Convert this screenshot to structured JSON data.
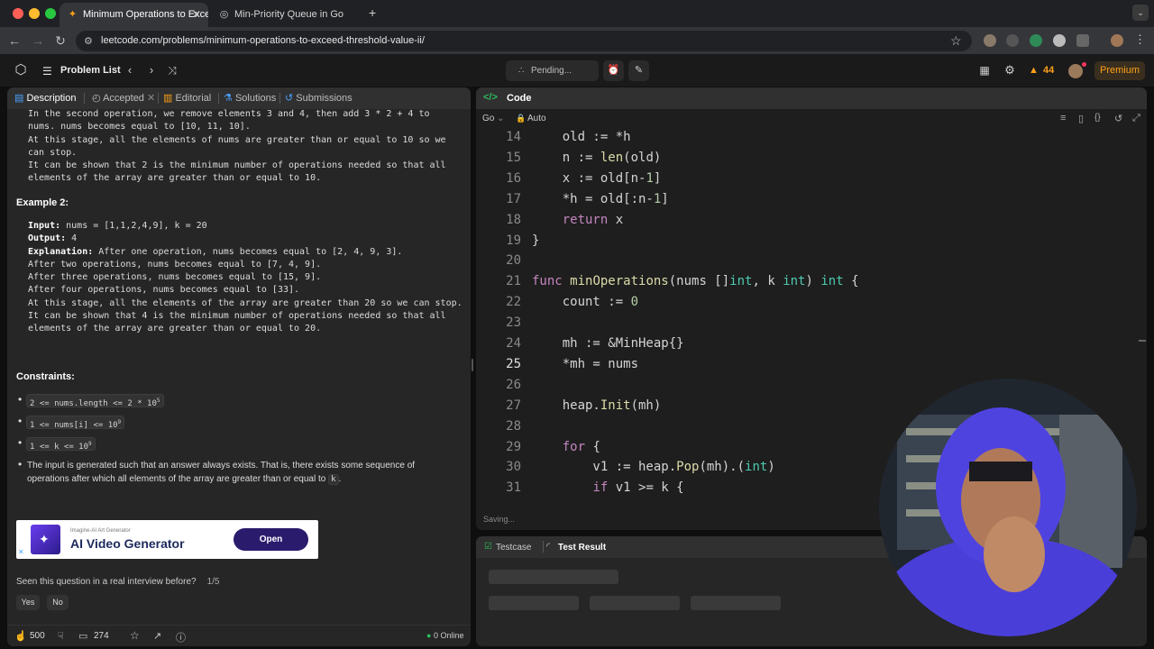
{
  "browser": {
    "tabs": [
      {
        "title": "Minimum Operations to Exce",
        "icon": "leetcode-icon",
        "active": true
      },
      {
        "title": "Min-Priority Queue in Go",
        "icon": "globe-icon",
        "active": false
      }
    ],
    "new_tab_label": "+",
    "url": "leetcode.com/problems/minimum-operations-to-exceed-threshold-value-ii/"
  },
  "leetcode_bar": {
    "problem_list_label": "Problem List",
    "pending_label": "Pending...",
    "streak_count": "44",
    "premium_label": "Premium"
  },
  "left_panel": {
    "tabs": [
      {
        "label": "Description",
        "icon": "document-icon",
        "active": true
      },
      {
        "label": "Accepted",
        "icon": "clock-icon",
        "active": false
      },
      {
        "label": "Editorial",
        "icon": "book-icon",
        "active": false
      },
      {
        "label": "Solutions",
        "icon": "flask-icon",
        "active": false
      },
      {
        "label": "Submissions",
        "icon": "history-icon",
        "active": false
      }
    ],
    "example1_tail": [
      "In the second operation, we remove elements 3 and 4, then add 3 * 2 + 4 to",
      "nums. nums becomes equal to [10, 11, 10].",
      "At this stage, all the elements of nums are greater than or equal to 10 so we",
      "can stop.",
      "It can be shown that 2 is the minimum number of operations needed so that all",
      "elements of the array are greater than or equal to 10."
    ],
    "example2_title": "Example 2:",
    "example2": {
      "input_label": "Input:",
      "input_value": " nums = [1,1,2,4,9], k = 20",
      "output_label": "Output:",
      "output_value": " 4",
      "explanation_label": "Explanation:",
      "explanation_first": " After one operation, nums becomes equal to [2, 4, 9, 3].",
      "explanation_rest": [
        "After two operations, nums becomes equal to [7, 4, 9].",
        "After three operations, nums becomes equal to [15, 9].",
        "After four operations, nums becomes equal to [33].",
        "At this stage, all the elements of the array are greater than 20 so we can stop.",
        "It can be shown that 4 is the minimum number of operations needed so that all",
        "elements of the array are greater than or equal to 20."
      ]
    },
    "constraints_title": "Constraints:",
    "constraints": [
      {
        "text": "2 <= nums.length <= 2 * 10",
        "sup": "5"
      },
      {
        "text": "1 <= nums[i] <= 10",
        "sup": "9"
      },
      {
        "text": "1 <= k <= 10",
        "sup": "9"
      }
    ],
    "note_line1": "The input is generated such that an answer always exists. That is, there exists some sequence of",
    "note_line2_pre": "operations after which all elements of the array are greater than or equal to ",
    "note_line2_code": "k",
    "note_line2_post": ".",
    "ad": {
      "small": "Imagine-AI Art Generator",
      "title": "AI Video Generator",
      "button": "Open"
    },
    "interview_question": "Seen this question in a real interview before?",
    "interview_count": "1/5",
    "yes_label": "Yes",
    "no_label": "No",
    "likes": "500",
    "comments": "274",
    "online": "0 Online"
  },
  "code_panel": {
    "title": "Code",
    "language": "Go",
    "mode": "Auto",
    "saving": "Saving...",
    "lines": [
      {
        "n": "14",
        "tokens": [
          [
            "    old := *h",
            ""
          ]
        ]
      },
      {
        "n": "15",
        "tokens": [
          [
            "    n := ",
            ""
          ],
          [
            "len",
            "fn"
          ],
          [
            "(old)",
            ""
          ]
        ]
      },
      {
        "n": "16",
        "tokens": [
          [
            "    x := old[n-",
            ""
          ],
          [
            "1",
            "nm"
          ],
          [
            "]",
            ""
          ]
        ]
      },
      {
        "n": "17",
        "tokens": [
          [
            "    *h = old[:n-",
            ""
          ],
          [
            "1",
            "nm"
          ],
          [
            "]",
            ""
          ]
        ]
      },
      {
        "n": "18",
        "tokens": [
          [
            "    ",
            ""
          ],
          [
            "return",
            "kw"
          ],
          [
            " x",
            ""
          ]
        ]
      },
      {
        "n": "19",
        "tokens": [
          [
            "}",
            ""
          ]
        ]
      },
      {
        "n": "20",
        "tokens": [
          [
            "",
            ""
          ]
        ]
      },
      {
        "n": "21",
        "tokens": [
          [
            "func",
            "kw"
          ],
          [
            " ",
            ""
          ],
          [
            "minOperations",
            "fn"
          ],
          [
            "(nums []",
            ""
          ],
          [
            "int",
            "ty"
          ],
          [
            ", k ",
            ""
          ],
          [
            "int",
            "ty"
          ],
          [
            ") ",
            ""
          ],
          [
            "int",
            "ty"
          ],
          [
            " {",
            ""
          ]
        ]
      },
      {
        "n": "22",
        "tokens": [
          [
            "    count := ",
            ""
          ],
          [
            "0",
            "nm"
          ]
        ]
      },
      {
        "n": "23",
        "tokens": [
          [
            "",
            ""
          ]
        ]
      },
      {
        "n": "24",
        "tokens": [
          [
            "    mh := &MinHeap{}",
            ""
          ]
        ]
      },
      {
        "n": "25",
        "tokens": [
          [
            "    *mh = nums",
            ""
          ]
        ]
      },
      {
        "n": "26",
        "tokens": [
          [
            "",
            ""
          ]
        ]
      },
      {
        "n": "27",
        "tokens": [
          [
            "    heap.",
            ""
          ],
          [
            "Init",
            "fn"
          ],
          [
            "(mh)",
            ""
          ]
        ]
      },
      {
        "n": "28",
        "tokens": [
          [
            "",
            ""
          ]
        ]
      },
      {
        "n": "29",
        "tokens": [
          [
            "    ",
            ""
          ],
          [
            "for",
            "kw"
          ],
          [
            " {",
            ""
          ]
        ]
      },
      {
        "n": "30",
        "tokens": [
          [
            "        v1 := heap.",
            ""
          ],
          [
            "Pop",
            "fn"
          ],
          [
            "(mh).(",
            ""
          ],
          [
            "int",
            "ty"
          ],
          [
            ")",
            ""
          ]
        ]
      },
      {
        "n": "31",
        "tokens": [
          [
            "        ",
            ""
          ],
          [
            "if",
            "kw"
          ],
          [
            " v1 >= k {",
            ""
          ]
        ]
      }
    ],
    "current_line": "25"
  },
  "test_panel": {
    "testcase_label": "Testcase",
    "result_label": "Test Result"
  },
  "colors": {
    "accent": "#ffa116",
    "check_green": "#2cbb5d"
  }
}
